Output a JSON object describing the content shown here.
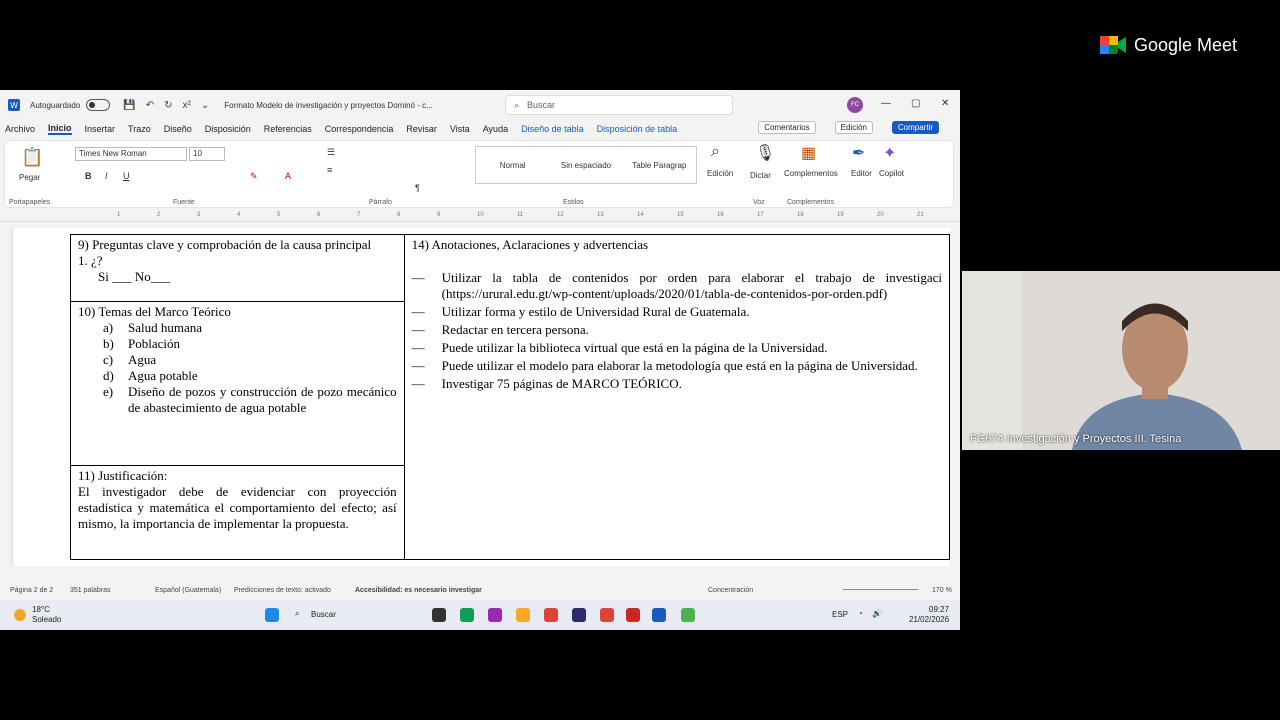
{
  "meet": {
    "brand": "Google Meet",
    "participant_caption": "FG674 Investigación y Proyectos III. Tesina"
  },
  "titlebar": {
    "autosave_label": "Autoguardado",
    "doc_title": "Formato Modelo de investigación y proyectos Dominó - c...",
    "search_placeholder": "Buscar",
    "avatar": "FC"
  },
  "menu": {
    "items": [
      "Archivo",
      "Inicio",
      "Insertar",
      "Trazo",
      "Diseño",
      "Disposición",
      "Referencias",
      "Correspondencia",
      "Revisar",
      "Vista",
      "Ayuda"
    ],
    "context_items": [
      "Diseño de tabla",
      "Disposición de tabla"
    ],
    "comments": "Comentarios",
    "editing": "Edición",
    "share": "Compartir"
  },
  "ribbon": {
    "paste": "Pegar",
    "font": "Times New Roman",
    "size": "10",
    "groups": [
      "Portapapeles",
      "Fuente",
      "Párrafo",
      "Estilos",
      "Voz",
      "Complementos"
    ],
    "styles": [
      "Normal",
      "Sin espaciado",
      "Table Paragrap"
    ],
    "buttons": [
      "Edición",
      "Dictar",
      "Complementos",
      "Editor",
      "Copilot"
    ]
  },
  "ruler_ticks": [
    "1",
    "2",
    "3",
    "4",
    "5",
    "6",
    "7",
    "8",
    "9",
    "10",
    "11",
    "12",
    "13",
    "14",
    "15",
    "16",
    "17",
    "18",
    "19",
    "20",
    "21"
  ],
  "doc": {
    "cell9_title": "9) Preguntas clave y comprobación de la causa principal",
    "cell9_q": "1.   ¿?",
    "cell9_answer": "Si ___ No___",
    "cell10_title": "10) Temas del Marco Teórico",
    "topics": [
      {
        "n": "a)",
        "t": "Salud humana"
      },
      {
        "n": "b)",
        "t": "Población"
      },
      {
        "n": "c)",
        "t": "Agua"
      },
      {
        "n": "d)",
        "t": "Agua potable"
      },
      {
        "n": "e)",
        "t": "Diseño de pozos y construcción de pozo mecánico de abastecimiento de agua potable"
      }
    ],
    "cell11_title": "11) Justificación:",
    "cell11_text": "El investigador debe de evidenciar con proyección estadística y matemática el comportamiento del efecto; así mismo, la importancia de implementar la propuesta.",
    "cell14_title": "14) Anotaciones, Aclaraciones y advertencias",
    "notes": [
      {
        "d": "—",
        "t": "Utilizar la tabla de contenidos por orden para elaborar el trabajo de investigaci (https://urural.edu.gt/wp-content/uploads/2020/01/tabla-de-contenidos-por-orden.pdf)"
      },
      {
        "d": "—",
        "t": "Utilizar forma y estilo de Universidad Rural de Guatemala."
      },
      {
        "d": "—",
        "t": "Redactar en tercera persona."
      },
      {
        "d": "—",
        "t": "Puede utilizar la biblioteca virtual que está en la página de la Universidad."
      },
      {
        "d": "—",
        "t": "Puede utilizar el modelo para elaborar la metodología que está en la página de Universidad."
      },
      {
        "d": "—",
        "t": "Investigar 75 páginas de MARCO TEÓRICO."
      }
    ]
  },
  "status": {
    "page": "Página 2 de 2",
    "words": "351 palabras",
    "language": "Español (Guatemala)",
    "predictions": "Predicciones de texto: activado",
    "accessibility": "Accesibilidad: es necesario investigar",
    "focus": "Concentración",
    "zoom": "170 %"
  },
  "taskbar": {
    "temp": "18°C",
    "weather": "Soleado",
    "search": "Buscar",
    "lang": "ESP",
    "time": "09:27",
    "date": "21/02/2026"
  }
}
